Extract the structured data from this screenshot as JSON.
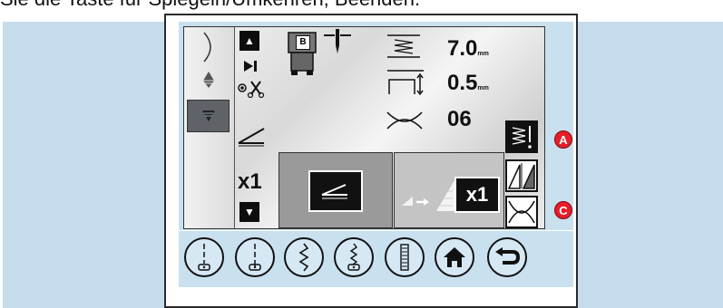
{
  "caption": "Sie die Taste für Spiegeln/Umkehren, Beenden.",
  "display": {
    "presser_foot_label": "B",
    "stitch_width_value": "7.0",
    "stitch_length_value": "0.5",
    "tension_value": "06",
    "unit": "mm",
    "repeat_left": "x1",
    "repeat_right": "x1"
  },
  "callouts": {
    "a": "A",
    "c": "C"
  },
  "bottom_icons": [
    "needle-stop-icon",
    "needle-down-icon",
    "zigzag-stitch-icon",
    "buttonhole-stitch-icon",
    "satin-column-icon",
    "home-icon",
    "back-arrow-icon"
  ]
}
